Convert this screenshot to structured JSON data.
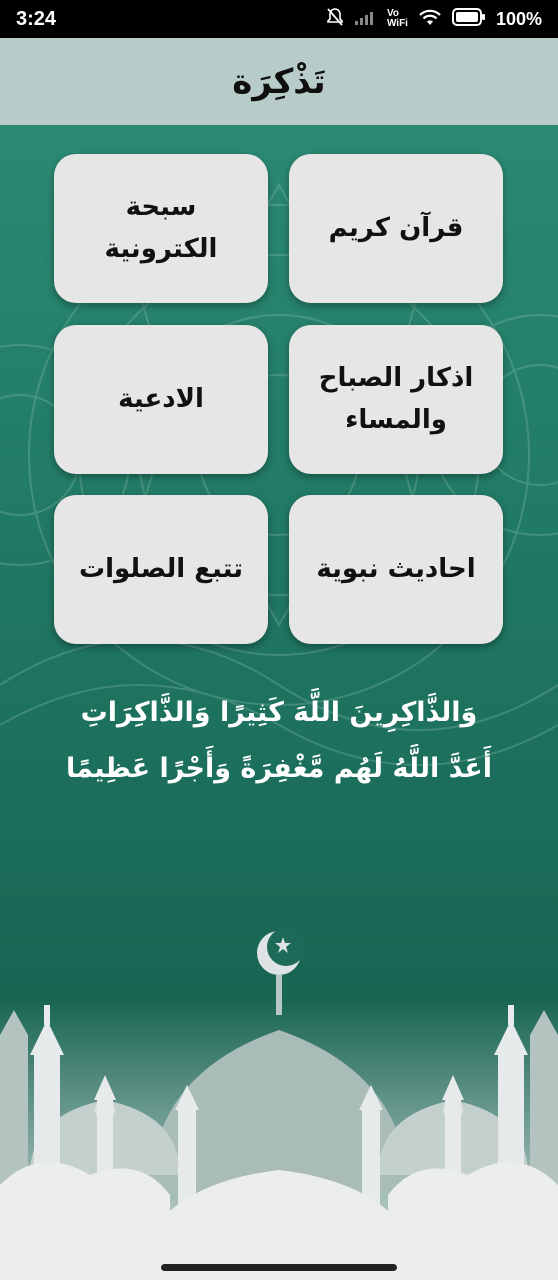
{
  "status_bar": {
    "time": "3:24",
    "volte": "Vo",
    "wifi_label": "WiFi",
    "battery": "100%"
  },
  "app_bar": {
    "title": "تَذْكِرَة"
  },
  "menu": {
    "quran": "قرآن كريم",
    "tasbih": "سبحة الكترونية",
    "azkar": "اذكار الصباح والمساء",
    "duas": "الادعية",
    "hadith": "احاديث نبوية",
    "prayers": "تتبع الصلوات"
  },
  "verse": {
    "line1": "وَالذَّاكِرِينَ اللَّهَ كَثِيرًا وَالذَّاكِرَاتِ",
    "line2": "أَعَدَّ اللَّهُ لَهُم مَّغْفِرَةً وَأَجْرًا عَظِيمًا"
  },
  "colors": {
    "app_bar": "#b7cbc8",
    "background_top": "#2f8f78",
    "background_bottom": "#186552",
    "card": "#e6e6e6",
    "mosque": "#dfe3e3"
  }
}
